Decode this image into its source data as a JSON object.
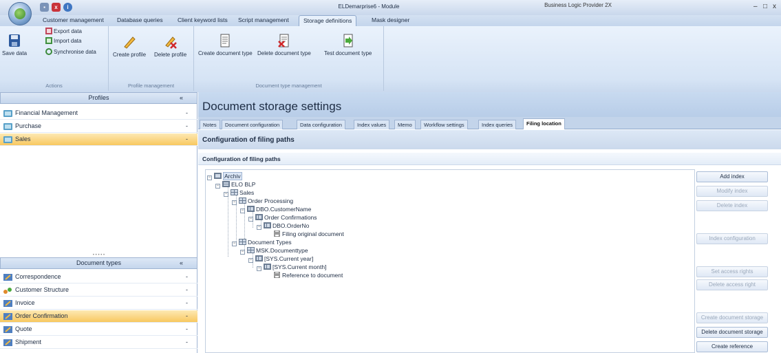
{
  "window": {
    "title": "ELDemarprise6 - Module",
    "app_title": "Business Logic Provider 2X",
    "controls": [
      "–",
      "□",
      "x"
    ]
  },
  "ribbon_tabs": [
    "Customer management",
    "Database queries",
    "Client keyword lists",
    "Script management",
    "Storage definitions",
    "Mask designer"
  ],
  "ribbon": {
    "actions": {
      "label": "Actions",
      "save": "Save data",
      "export": "Export data",
      "import": "Import data",
      "sync": "Synchronise data"
    },
    "profile_mgmt": {
      "label": "Profile management",
      "create": "Create profile",
      "delete": "Delete profile"
    },
    "doctype_mgmt": {
      "label": "Document type management",
      "create": "Create document type",
      "delete": "Delete document type",
      "test": "Test document type"
    }
  },
  "profiles": {
    "header": "Profiles",
    "items": [
      "Financial Management",
      "Purchase",
      "Sales"
    ],
    "selected": "Sales"
  },
  "document_types": {
    "header": "Document types",
    "items": [
      "Correspondence",
      "Customer Structure",
      "Invoice",
      "Order Confirmation",
      "Quote",
      "Shipment"
    ],
    "selected": "Order Confirmation"
  },
  "content": {
    "title": "Document storage settings",
    "tabs": [
      "Notes",
      "Document configuration",
      "Data configuration",
      "Index values",
      "Memo",
      "Workflow settings",
      "Index queries",
      "Filing location"
    ],
    "active_tab": "Filing location",
    "config_title": "Configuration of filing paths",
    "section_title": "Configuration of filing paths"
  },
  "tree": {
    "archiv": "Archiv",
    "elo": "ELO BLP",
    "sales": "Sales",
    "order_processing": "Order Processing",
    "customer_name": "DBO.CustomerName",
    "order_confirmations": "Order Confirmations",
    "order_no": "DBO.OrderNo",
    "filing_original": "Filing original document",
    "document_types": "Document Types",
    "msk_doctype": "MSK.Documenttype",
    "sys_year": "[SYS.Current year]",
    "sys_month": "[SYS.Current month]",
    "reference": "Reference to document"
  },
  "buttons": {
    "add_index": "Add index",
    "modify_index": "Modify index",
    "delete_index": "Delete index",
    "index_config": "Index configuration",
    "set_access": "Set access rights",
    "delete_access": "Delete access right",
    "create_storage": "Create document storage",
    "delete_storage": "Delete document storage",
    "create_reference": "Create reference"
  },
  "colors": {
    "accent": "#f8c860",
    "header": "#c8daf0",
    "ribbon": "#d6e4f5"
  }
}
